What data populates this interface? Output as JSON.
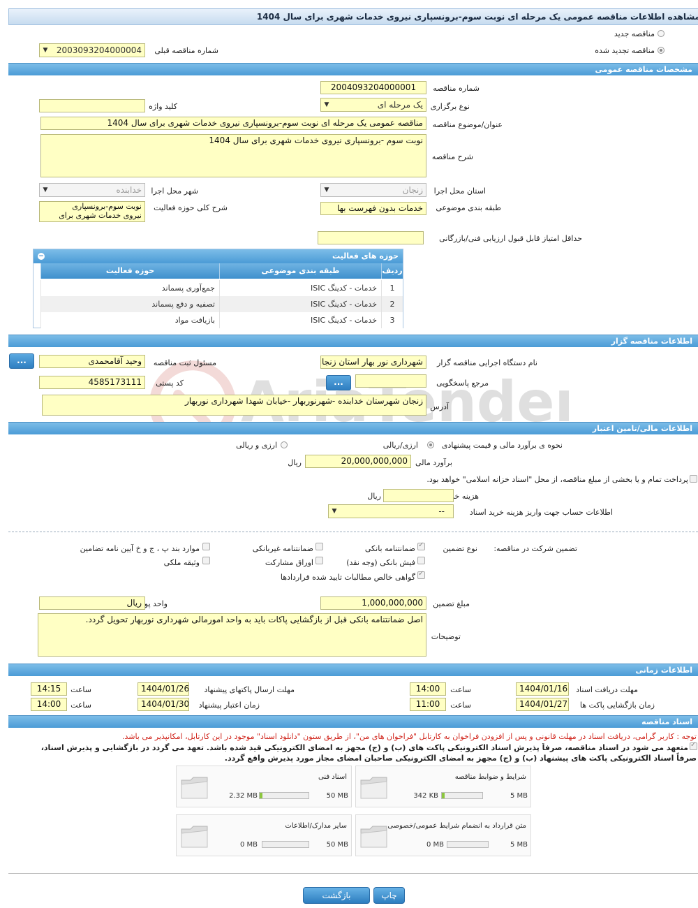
{
  "title": "مشاهده اطلاعات مناقصه عمومی یک مرحله ای نوبت سوم-برونسپاری نیروی خدمات شهری برای سال 1404",
  "top": {
    "new_label": "مناقصه جدید",
    "renewed_label": "مناقصه تجدید شده",
    "prev_number_label": "شماره مناقصه قبلی",
    "prev_number_value": "2003093204000004"
  },
  "general": {
    "header": "مشخصات مناقصه عمومی",
    "number_label": "شماره مناقصه",
    "number_value": "2004093204000001",
    "type_label": "نوع برگزاری",
    "type_value": "یک مرحله ای",
    "keyword_label": "کلید واژه",
    "keyword_value": "",
    "subject_label": "عنوان/موضوع مناقصه",
    "subject_value": "مناقصه عمومی یک مرحله ای  نوبت سوم-برونسپاری نیروی خدمات شهری برای سال 1404",
    "desc_label": "شرح مناقصه",
    "desc_value": "نوبت سوم -برونسپاری نیروی خدمات شهری برای سال 1404",
    "province_label": "استان محل اجرا",
    "province_value": "زنجان",
    "city_label": "شهر محل اجرا",
    "city_value": "خدابنده",
    "category_label": "طبقه بندی موضوعی",
    "category_value": "خدمات بدون فهرست بها",
    "scope_label": "شرح کلی حوزه فعالیت",
    "scope_value_1": "نوبت سوم-برونسپاری",
    "scope_value_2": "نیروی خدمات شهری برای",
    "min_score_label": "حداقل امتیاز قابل قبول ارزیابی فنی/بازرگانی",
    "min_score_value": ""
  },
  "activity": {
    "header": "حوزه های فعالیت",
    "col_row": "ردیف",
    "col_category": "طبقه بندی موضوعی",
    "col_area": "حوزه فعالیت",
    "rows": [
      {
        "n": "1",
        "category": "خدمات - کدینگ ISIC",
        "area": "جمع‌آوری پسماند"
      },
      {
        "n": "2",
        "category": "خدمات - کدینگ ISIC",
        "area": "تصفیه و دفع پسماند"
      },
      {
        "n": "3",
        "category": "خدمات - کدینگ ISIC",
        "area": "بازیافت مواد"
      }
    ]
  },
  "organizer": {
    "header": "اطلاعات مناقصه گزار",
    "org_label": "نام دستگاه اجرایی مناقصه گزار",
    "org_value": "شهرداری نور بهار استان زنجان",
    "responsible_label": "مسئول ثبت مناقصه",
    "responsible_value": "وحید آقامحمدی",
    "ref_label": "مرجع پاسخگویی",
    "ref_value": "",
    "postal_label": "کد پستی",
    "postal_value": "4585173111",
    "address_label": "آدرس",
    "address_value": "زنجان شهرستان خدابنده -شهرنوربهار -خیابان شهدا شهرداری نوربهار",
    "dots": "..."
  },
  "finance": {
    "header": "اطلاعات مالی/تامین اعتبار",
    "method_label": "نحوه ی برآورد مالی و قیمت پیشنهادی",
    "opt_rial": "ارزی/ریالی",
    "opt_fx": "ارزی و ریالی",
    "estimate_label": "برآورد مالی",
    "estimate_value": "20,000,000,000",
    "rial": "ریال",
    "treasury_text": "پرداخت تمام و یا بخشی از مبلغ مناقصه، از محل \"اسناد خزانه اسلامی\" خواهد بود.",
    "doc_cost_label": "هزینه خرید اسناد",
    "doc_cost_value": "",
    "account_label": "اطلاعات حساب جهت واریز هزینه خرید اسناد",
    "account_value": "--"
  },
  "guarantee": {
    "participation_label": "تضمین شرکت در مناقصه:",
    "type_label": "نوع تضمین",
    "bank_guarantee": "ضمانتنامه بانکی",
    "nonbank_guarantee": "ضمانتنامه غیربانکی",
    "clauses": "موارد بند پ ، ج و خ آیین نامه تضامین",
    "bank_receipt": "فیش بانکی (وجه نقد)",
    "bonds": "اوراق مشارکت",
    "property": "وثیقه ملکی",
    "cert": "گواهی خالص مطالبات تایید شده قراردادها",
    "amount_label": "مبلغ تضمین",
    "amount_value": "1,000,000,000",
    "currency_label": "واحد پول",
    "currency_value": "ریال",
    "notes_label": "توضیحات",
    "notes_value": "اصل ضمانتنامه بانکی قبل از بازگشایی پاکات باید به واحد امورمالی شهرداری نوربهار تحویل گردد."
  },
  "timing": {
    "header": "اطلاعات زمانی",
    "doc_deadline_label": "مهلت دریافت اسناد",
    "doc_deadline_date": "1404/01/16",
    "doc_deadline_time": "14:00",
    "send_deadline_label": "مهلت ارسال پاکتهای پیشنهاد",
    "send_deadline_date": "1404/01/26",
    "send_deadline_time": "14:15",
    "open_label": "زمان بازگشایی پاکت ها",
    "open_date": "1404/01/27",
    "open_time": "11:00",
    "validity_label": "زمان اعتبار پیشنهاد",
    "validity_date": "1404/01/30",
    "validity_time": "14:00",
    "time_label": "ساعت"
  },
  "docs": {
    "header": "اسناد مناقصه",
    "note_red": "توجه : کاربر گرامی، دریافت اسناد در مهلت قانونی و پس از افزودن فراخوان به کارتابل \"فراخوان های من\"، از طریق ستون \"دانلود اسناد\" موجود در این کارتابل، امکانپذیر می باشد.",
    "commit_1": "متعهد می شود در اسناد مناقصه، صرفاً پذیرش اسناد الکترونیکی پاکت های (ب) و (ج) مجهز به امضای الکترونیکی قید شده باشد. تعهد می گردد در بازگشایی و پذیرش اسناد،",
    "commit_2": "صرفاً اسناد الکترونیکی پاکت های پیشنهاد (ب) و (ج) مجهز به امضای الکترونیکی صاحبان امضای مجاز مورد پذیرش واقع گردد.",
    "boxes": [
      {
        "title": "شرایط و ضوابط مناقصه",
        "used": "342 KB",
        "max": "5 MB",
        "fill": 0.07
      },
      {
        "title": "اسناد فنی",
        "used": "2.32 MB",
        "max": "50 MB",
        "fill": 0.05
      },
      {
        "title": "متن قرارداد به انضمام شرایط عمومی/خصوصی",
        "used": "0 MB",
        "max": "5 MB",
        "fill": 0
      },
      {
        "title": "سایر مدارک/اطلاعات",
        "used": "0 MB",
        "max": "50 MB",
        "fill": 0
      }
    ]
  },
  "actions": {
    "print": "چاپ",
    "back": "بازگشت"
  },
  "watermark": "AriaTender.neT"
}
